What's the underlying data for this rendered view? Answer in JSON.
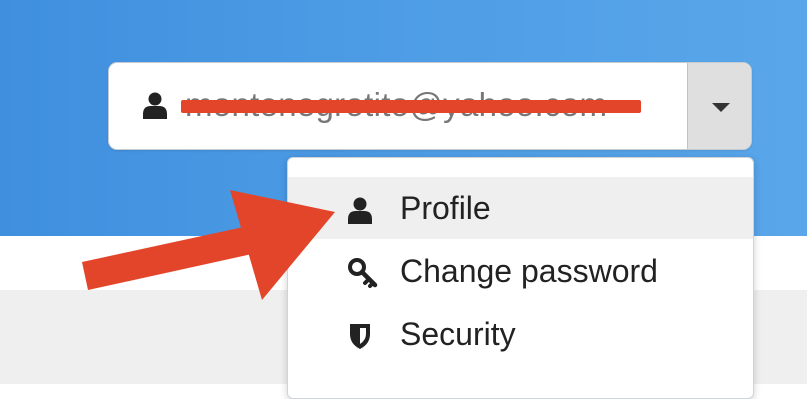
{
  "user_menu": {
    "account_email": "montenegrotito@yahoo.com",
    "toggle_icon": "caret-down-icon",
    "items": [
      {
        "label": "Profile",
        "icon": "user-icon",
        "active": true
      },
      {
        "label": "Change password",
        "icon": "key-icon",
        "active": false
      },
      {
        "label": "Security",
        "icon": "shield-icon",
        "active": false
      }
    ]
  },
  "colors": {
    "header": "#4a9be4",
    "annotation": "#e3452a",
    "menu_hover": "#efefef"
  }
}
